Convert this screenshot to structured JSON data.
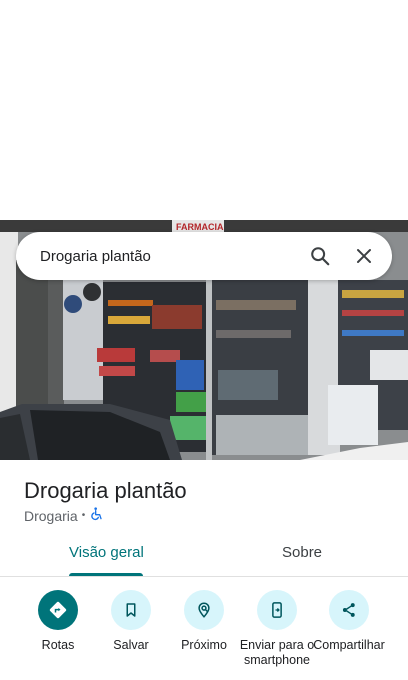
{
  "search": {
    "value": "Drogaria plantão"
  },
  "photo": {
    "sign_text": "FARMACIA"
  },
  "place": {
    "title": "Drogaria plantão",
    "category": "Drogaria",
    "separator": "•"
  },
  "tabs": [
    {
      "label": "Visão geral",
      "active": true
    },
    {
      "label": "Sobre",
      "active": false
    }
  ],
  "actions": [
    {
      "label": "Rotas",
      "icon": "directions-icon"
    },
    {
      "label": "Salvar",
      "icon": "bookmark-icon"
    },
    {
      "label": "Próximo",
      "icon": "nearby-icon"
    },
    {
      "label": "Enviar para o smartphone",
      "icon": "send-to-phone-icon"
    },
    {
      "label": "Compartilhar",
      "icon": "share-icon"
    }
  ],
  "colors": {
    "accent": "#00747a",
    "action_bg": "#d7f5fb",
    "text": "#202124",
    "subtext": "#5f6368"
  }
}
